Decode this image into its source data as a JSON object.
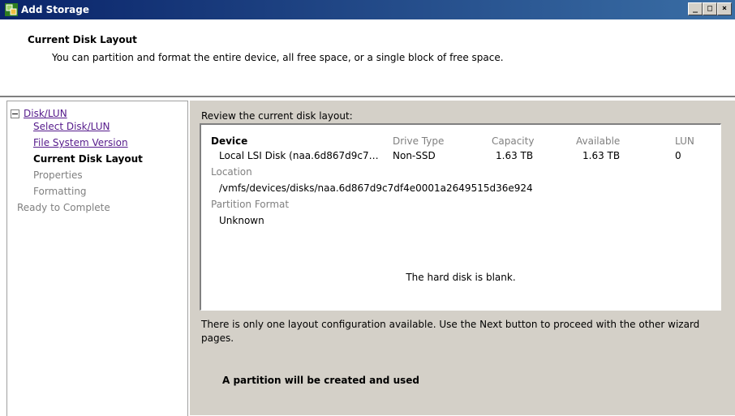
{
  "window": {
    "title": "Add Storage",
    "icon": "vsphere-add-storage-icon"
  },
  "header": {
    "title": "Current Disk Layout",
    "description": "You can partition and format the entire device, all free space, or a single block of free space."
  },
  "nav": {
    "section": "Disk/LUN",
    "items": [
      {
        "label": "Select Disk/LUN",
        "state": "link"
      },
      {
        "label": "File System Version",
        "state": "link"
      },
      {
        "label": "Current Disk Layout",
        "state": "current"
      },
      {
        "label": "Properties",
        "state": "disabled"
      },
      {
        "label": "Formatting",
        "state": "disabled"
      }
    ],
    "final": "Ready to Complete"
  },
  "main": {
    "prompt": "Review the current disk layout:",
    "table": {
      "columns": [
        "Device",
        "Drive Type",
        "Capacity",
        "Available",
        "LUN"
      ],
      "row": [
        "Local LSI Disk (naa.6d867d9c7…",
        "Non-SSD",
        "1.63 TB",
        "1.63 TB",
        "0"
      ],
      "location_label": "Location",
      "location_value": "/vmfs/devices/disks/naa.6d867d9c7df4e0001a2649515d36e924",
      "partition_label": "Partition Format",
      "partition_value": "Unknown",
      "blank_message": "The hard disk is blank."
    },
    "info": "There is only one layout configuration available. Use the Next button to proceed with the other wizard pages.",
    "partition_message": "A partition will be created and used"
  },
  "colors": {
    "titlebar": "#0a246a",
    "panel": "#d4d0c8",
    "link": "#551a8b",
    "disabled": "#808080"
  }
}
